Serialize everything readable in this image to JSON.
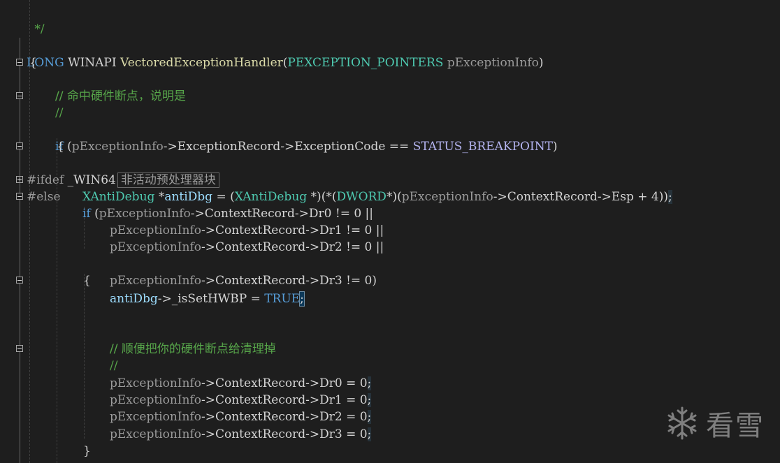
{
  "editor": {
    "lines": [
      {
        "id": "l0",
        "text": " */"
      },
      {
        "id": "l1",
        "text": "LONG WINAPI VectoredExceptionHandler(PEXCEPTION_POINTERS pExceptionInfo)"
      },
      {
        "id": "l2",
        "text": "{"
      },
      {
        "id": "l3",
        "text": "//"
      },
      {
        "id": "l4",
        "text": "// 命中硬件断点，说明是"
      },
      {
        "id": "l5",
        "text": "//"
      },
      {
        "id": "l6",
        "text": "if (pExceptionInfo->ExceptionRecord->ExceptionCode == STATUS_BREAKPOINT)"
      },
      {
        "id": "l7",
        "text": "{"
      },
      {
        "id": "l8",
        "text": "#ifdef _WIN64"
      },
      {
        "id": "l9",
        "text": "#else"
      },
      {
        "id": "l10",
        "text": "XAntiDebug *antiDbg = (XAntiDebug *)(*(DWORD*)(pExceptionInfo->ContextRecord->Esp + 4));"
      },
      {
        "id": "l11",
        "text": "if (pExceptionInfo->ContextRecord->Dr0 != 0 ||"
      },
      {
        "id": "l12",
        "text": "pExceptionInfo->ContextRecord->Dr1 != 0 ||"
      },
      {
        "id": "l13",
        "text": "pExceptionInfo->ContextRecord->Dr2 != 0 ||"
      },
      {
        "id": "l14",
        "text": "pExceptionInfo->ContextRecord->Dr3 != 0)"
      },
      {
        "id": "l15",
        "text": "{"
      },
      {
        "id": "l16",
        "text": "antiDbg->_isSetHWBP = TRUE;"
      },
      {
        "id": "l17",
        "text": "//"
      },
      {
        "id": "l18",
        "text": "// 顺便把你的硬件断点给清理掉"
      },
      {
        "id": "l19",
        "text": "//"
      },
      {
        "id": "l20",
        "text": "pExceptionInfo->ContextRecord->Dr0 = 0;"
      },
      {
        "id": "l21",
        "text": "pExceptionInfo->ContextRecord->Dr1 = 0;"
      },
      {
        "id": "l22",
        "text": "pExceptionInfo->ContextRecord->Dr2 = 0;"
      },
      {
        "id": "l23",
        "text": "pExceptionInfo->ContextRecord->Dr3 = 0;"
      },
      {
        "id": "l24",
        "text": "}"
      }
    ],
    "inactive_block_label": "非活动预处理器块"
  },
  "watermark": {
    "text": "看雪"
  },
  "colors": {
    "background": "#1e1e1e",
    "keyword": "#569cd6",
    "type": "#4ec9b0",
    "comment": "#57a64a",
    "preprocessor": "#9b9b9b",
    "constant": "#b4b4f0"
  },
  "icons": {
    "fold_collapse": "minus-box-icon",
    "fold_expand": "plus-box-icon",
    "watermark_logo": "snowflake-icon"
  }
}
